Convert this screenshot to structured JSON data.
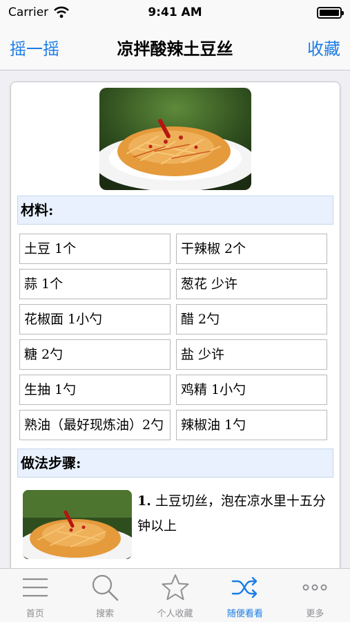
{
  "status": {
    "carrier": "Carrier",
    "time": "9:41 AM"
  },
  "nav": {
    "left": "摇一摇",
    "title": "凉拌酸辣土豆丝",
    "right": "收藏"
  },
  "recipe": {
    "ingredients_title": "材料:",
    "ingredients": [
      "土豆 1个",
      "干辣椒 2个",
      "蒜 1个",
      "葱花 少许",
      "花椒面 1小勺",
      "醋 2勺",
      "糖 2勺",
      "盐 少许",
      "生抽 1勺",
      "鸡精 1小勺",
      "熟油（最好现炼油）2勺",
      "辣椒油 1勺"
    ],
    "steps_title": "做法步骤:",
    "steps": [
      {
        "num": "1.",
        "text": "土豆切丝，泡在凉水里十五分钟以上"
      }
    ]
  },
  "tabs": [
    {
      "label": "首页",
      "icon": "menu-icon"
    },
    {
      "label": "搜索",
      "icon": "search-icon"
    },
    {
      "label": "个人收藏",
      "icon": "star-icon"
    },
    {
      "label": "随便看看",
      "icon": "shuffle-icon",
      "active": true
    },
    {
      "label": "更多",
      "icon": "more-icon"
    }
  ],
  "colors": {
    "accent": "#1a7ce6",
    "section_bg": "#e8f1fd",
    "tab_inactive": "#8e8e93"
  }
}
